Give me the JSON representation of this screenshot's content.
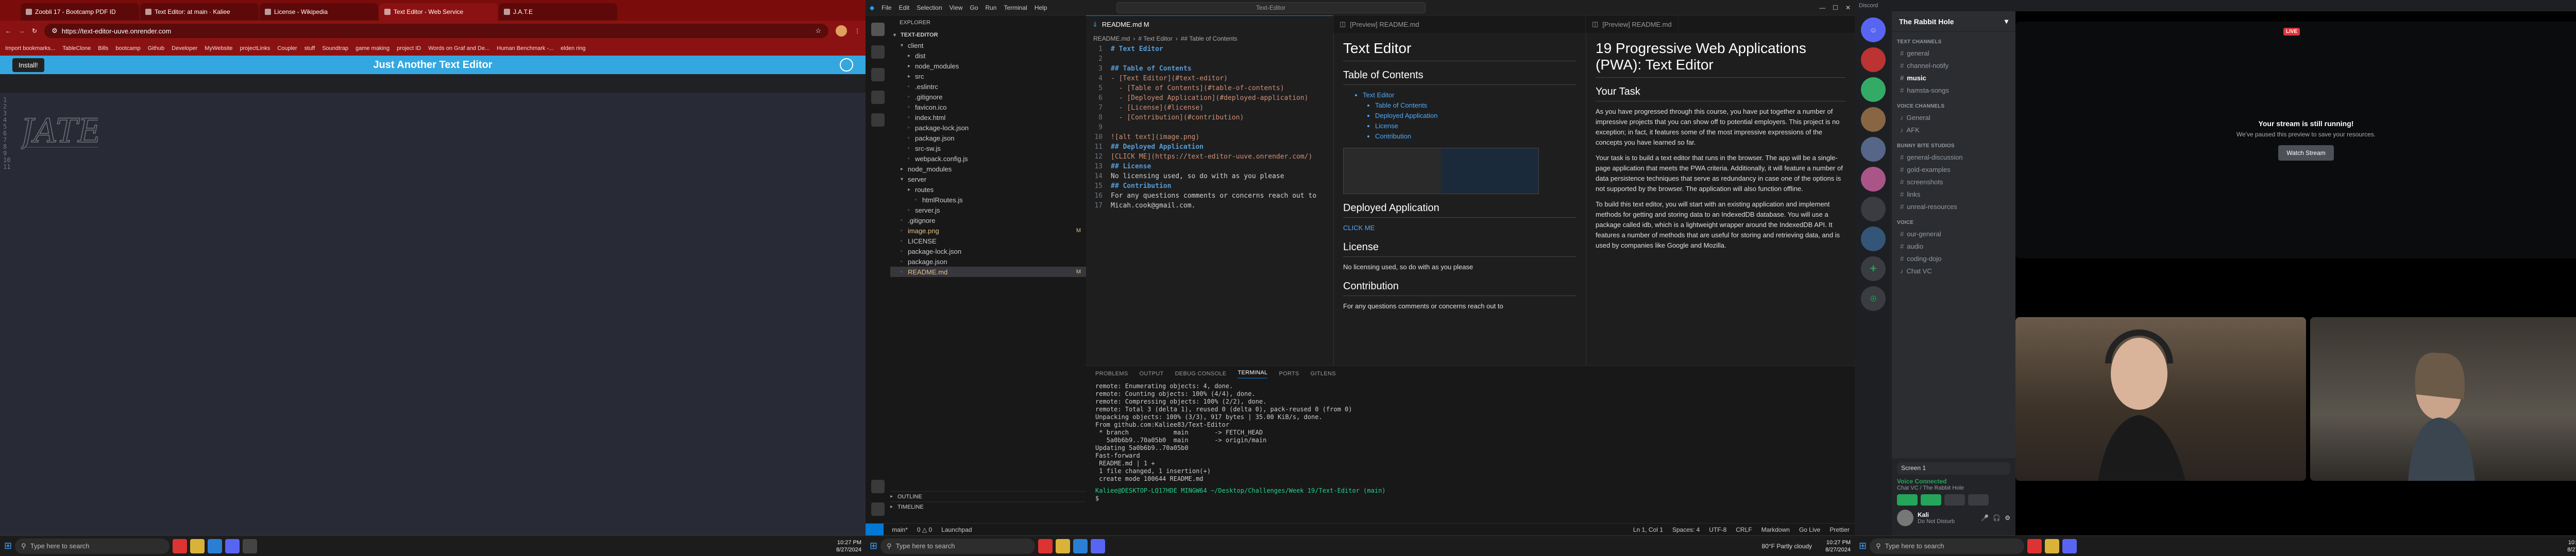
{
  "browser": {
    "tabs": [
      "Zoobli 17 - Bootcamp PDF ID",
      "Text Editor: at main · Kaliee",
      "License - Wikipedia",
      "Text Editor - Web Service",
      "J.A.T.E"
    ],
    "url": "https://text-editor-uuve.onrender.com",
    "bookmarks": [
      "Import bookmarks...",
      "TableClone",
      "Bills",
      "bootcamp",
      "Github",
      "Developer",
      "MyWebsite",
      "projectLinks",
      "Coupler",
      "stuff",
      "Soundtrap",
      "game making",
      "project ID",
      "Words on Graf and De...",
      "Human Benchmark -...",
      "elden ring"
    ],
    "install_label": "Install!",
    "app_title": "Just Another Text Editor",
    "line_numbers": [
      "1",
      "2",
      "3",
      "4",
      "5",
      "6",
      "7",
      "8",
      "9",
      "10",
      "11"
    ]
  },
  "vscode": {
    "menu": [
      "File",
      "Edit",
      "Selection",
      "View",
      "Go",
      "Run",
      "Terminal",
      "Help"
    ],
    "command_center": "Text-Editor",
    "explorer_title": "EXPLORER",
    "project": "TEXT-EDITOR",
    "tree": [
      {
        "name": "client",
        "depth": 1,
        "folder": true,
        "open": true
      },
      {
        "name": "dist",
        "depth": 2,
        "folder": true
      },
      {
        "name": "node_modules",
        "depth": 2,
        "folder": true
      },
      {
        "name": "src",
        "depth": 2,
        "folder": true
      },
      {
        "name": ".eslintrc",
        "depth": 2
      },
      {
        "name": ".gitignore",
        "depth": 2
      },
      {
        "name": "favicon.ico",
        "depth": 2
      },
      {
        "name": "index.html",
        "depth": 2
      },
      {
        "name": "package-lock.json",
        "depth": 2
      },
      {
        "name": "package.json",
        "depth": 2
      },
      {
        "name": "src-sw.js",
        "depth": 2
      },
      {
        "name": "webpack.config.js",
        "depth": 2
      },
      {
        "name": "node_modules",
        "depth": 1,
        "folder": true
      },
      {
        "name": "server",
        "depth": 1,
        "folder": true,
        "open": true
      },
      {
        "name": "routes",
        "depth": 2,
        "folder": true
      },
      {
        "name": "htmlRoutes.js",
        "depth": 3
      },
      {
        "name": "server.js",
        "depth": 2
      },
      {
        "name": ".gitignore",
        "depth": 1
      },
      {
        "name": "image.png",
        "depth": 1,
        "mod": "M"
      },
      {
        "name": "LICENSE",
        "depth": 1
      },
      {
        "name": "package-lock.json",
        "depth": 1
      },
      {
        "name": "package.json",
        "depth": 1
      },
      {
        "name": "README.md",
        "depth": 1,
        "mod": "M",
        "selected": true
      }
    ],
    "outline_label": "OUTLINE",
    "timeline_label": "TIMELINE",
    "tabs": [
      "README.md M",
      "[Preview] README.md",
      "[Preview] README.md"
    ],
    "breadcrumbs": [
      "README.md",
      "# Text Editor",
      "## Table of Contents"
    ],
    "code_lines": [
      {
        "n": "1",
        "t": "# Text Editor",
        "c": "md-h"
      },
      {
        "n": "2",
        "t": "",
        "c": "md-t"
      },
      {
        "n": "3",
        "t": "## Table of Contents",
        "c": "md-h"
      },
      {
        "n": "4",
        "t": "- [Text Editor](#text-editor)",
        "c": "md-l"
      },
      {
        "n": "5",
        "t": "  - [Table of Contents](#table-of-contents)",
        "c": "md-l"
      },
      {
        "n": "6",
        "t": "  - [Deployed Application](#deployed-application)",
        "c": "md-l"
      },
      {
        "n": "7",
        "t": "  - [License](#license)",
        "c": "md-l"
      },
      {
        "n": "8",
        "t": "  - [Contribution](#contribution)",
        "c": "md-l"
      },
      {
        "n": "9",
        "t": "",
        "c": "md-t"
      },
      {
        "n": "10",
        "t": "![alt text](image.png)",
        "c": "md-l"
      },
      {
        "n": "11",
        "t": "## Deployed Application",
        "c": "md-h"
      },
      {
        "n": "12",
        "t": "[CLICK ME](https://text-editor-uuve.onrender.com/)",
        "c": "md-l"
      },
      {
        "n": "13",
        "t": "## License",
        "c": "md-h"
      },
      {
        "n": "14",
        "t": "No licensing used, so do with as you please",
        "c": "md-t"
      },
      {
        "n": "15",
        "t": "## Contribution",
        "c": "md-h"
      },
      {
        "n": "16",
        "t": "For any questions comments or concerns reach out to",
        "c": "md-t"
      },
      {
        "n": "17",
        "t": "Micah.cook@gmail.com.",
        "c": "md-t"
      }
    ],
    "preview1": {
      "h1": "Text Editor",
      "toc": "Table of Contents",
      "toc_items": [
        "Text Editor",
        "Table of Contents",
        "Deployed Application",
        "License",
        "Contribution"
      ],
      "deployed": "Deployed Application",
      "click": "CLICK ME",
      "license": "License",
      "license_text": "No licensing used, so do with as you please",
      "contribution": "Contribution",
      "contrib_text": "For any questions comments or concerns reach out to"
    },
    "preview2": {
      "h1": "19 Progressive Web Applications (PWA): Text Editor",
      "task": "Your Task",
      "p1": "As you have progressed through this course, you have put together a number of impressive projects that you can show off to potential employers. This project is no exception; in fact, it features some of the most impressive expressions of the concepts you have learned so far.",
      "p2": "Your task is to build a text editor that runs in the browser. The app will be a single-page application that meets the PWA criteria. Additionally, it will feature a number of data persistence techniques that serve as redundancy in case one of the options is not supported by the browser. The application will also function offline.",
      "p3": "To build this text editor, you will start with an existing application and implement methods for getting and storing data to an IndexedDB database. You will use a package called idb, which is a lightweight wrapper around the IndexedDB API. It features a number of methods that are useful for storing and retrieving data, and is used by companies like Google and Mozilla."
    },
    "panel_tabs": [
      "PROBLEMS",
      "OUTPUT",
      "DEBUG CONSOLE",
      "TERMINAL",
      "PORTS",
      "GITLENS"
    ],
    "active_panel": "TERMINAL",
    "terminal": [
      "remote: Enumerating objects: 4, done.",
      "remote: Counting objects: 100% (4/4), done.",
      "remote: Compressing objects: 100% (2/2), done.",
      "remote: Total 3 (delta 1), reused 0 (delta 0), pack-reused 0 (from 0)",
      "Unpacking objects: 100% (3/3), 917 bytes | 35.00 KiB/s, done.",
      "From github.com:Kaliee83/Text-Editor",
      " * branch            main       -> FETCH_HEAD",
      "   5a0b6b9..70a05b0  main       -> origin/main",
      "Updating 5a0b6b9..70a05b0",
      "Fast-forward",
      " README.md | 1 +",
      " 1 file changed, 1 insertion(+)",
      " create mode 100644 README.md",
      "Kaliee@DESKTOP-LQ17HDE MINGW64 ~/Desktop/Challenges/Week 19/Text-Editor (main)",
      "$ "
    ],
    "status_items": [
      "main*",
      "0 △ 0",
      "Launchpad",
      "Ln 1, Col 1",
      "Spaces: 4",
      "UTF-8",
      "CRLF",
      "Markdown",
      "Go Live",
      "Prettier"
    ]
  },
  "discord": {
    "server_name": "The Rabbit Hole",
    "categories": [
      {
        "name": "TEXT CHANNELS",
        "channels": [
          "general",
          "channel-notify",
          "music",
          "hamsta-songs"
        ]
      },
      {
        "name": "VOICE CHANNELS",
        "channels": [
          "General",
          "AFK"
        ]
      },
      {
        "name": "BUNNY BITE STUDIOS",
        "channels": [
          "general-discussion",
          "gold-examples",
          "screenshots",
          "links",
          "unreal-resources"
        ]
      },
      {
        "name": "VOICE",
        "channels": [
          "our-general",
          "audio",
          "coding-dojo",
          "Chat VC"
        ]
      }
    ],
    "selected_channel": "music",
    "stream_title": "Your stream is still running!",
    "stream_sub": "We've paused this preview to save your resources.",
    "watch_label": "Watch Stream",
    "live_badge": "LIVE",
    "voice_status": "Voice Connected",
    "voice_channel": "Chat VC / The Rabbit Hole",
    "user_name": "Kali",
    "user_status": "Do Not Disturb",
    "screen_label": "Screen 1"
  },
  "taskbar": {
    "search": "Type here to search",
    "time": "10:27 PM",
    "date": "8/27/2024",
    "weather": "80°F Partly cloudy"
  }
}
